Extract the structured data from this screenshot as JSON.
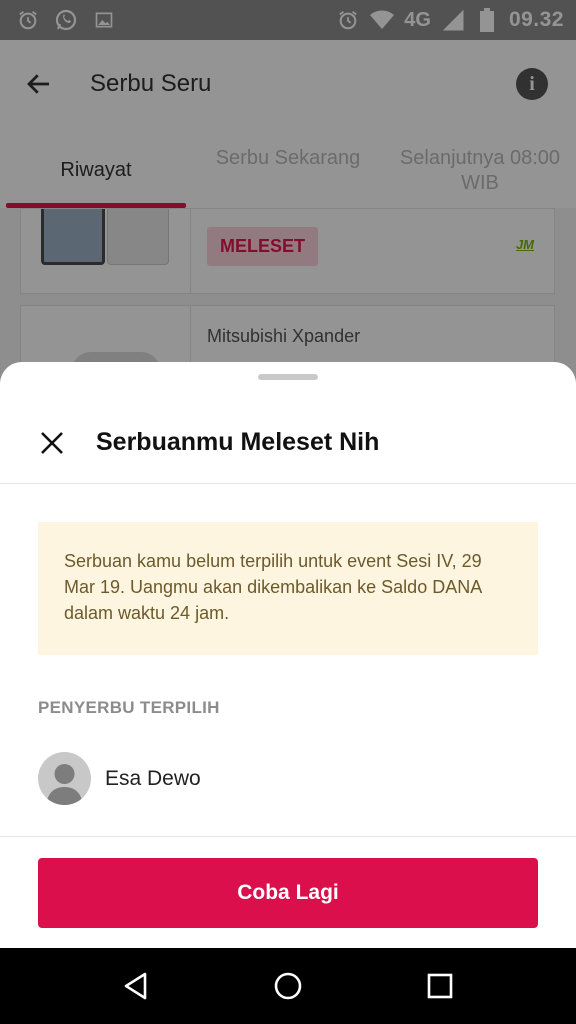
{
  "status_bar": {
    "network": "4G",
    "time": "09.32"
  },
  "app": {
    "title": "Serbu Seru",
    "tabs": [
      {
        "label": "Riwayat"
      },
      {
        "label": "Serbu Sekarang"
      },
      {
        "label": "Selanjutnya 08:00 WIB"
      }
    ],
    "cards": [
      {
        "badge": "MELESET",
        "partner_logo": "JM"
      },
      {
        "product_name": "Mitsubishi Xpander"
      }
    ]
  },
  "sheet": {
    "title": "Serbuanmu Meleset Nih",
    "notice": "Serbuan kamu belum terpilih untuk event Sesi IV, 29 Mar 19. Uangmu akan dikembalikan ke Saldo DANA dalam waktu 24 jam.",
    "section_label": "PENYERBU TERPILIH",
    "selected_user": {
      "name": "Esa Dewo"
    },
    "cta_label": "Coba Lagi"
  },
  "colors": {
    "accent": "#da0f4b",
    "notice_bg": "#fef5e0",
    "status_bar": "#8e8e8e"
  }
}
